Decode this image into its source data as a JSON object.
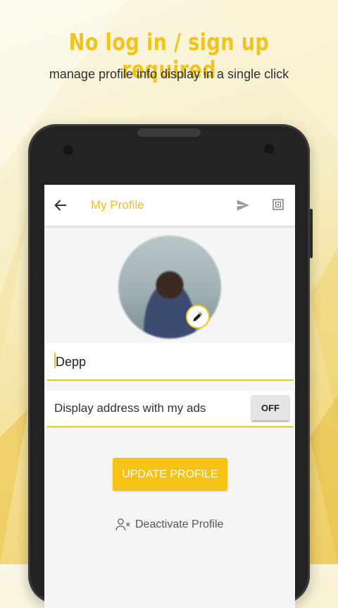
{
  "promo": {
    "headline": "No log in / sign up required",
    "subline": "manage profile info display in a single click"
  },
  "app": {
    "title": "My Profile",
    "icons": {
      "back": "arrow-left-icon",
      "send": "send-icon",
      "qr": "qr-code-icon",
      "edit": "pencil-icon",
      "deactivate": "user-remove-icon"
    }
  },
  "profile": {
    "name_value": "Depp",
    "display_address_label": "Display address with my ads",
    "display_address_toggle": "OFF",
    "update_button": "UPDATE PROFILE",
    "deactivate_label": "Deactivate Profile"
  },
  "colors": {
    "accent": "#f2c318",
    "button": "#f6c215",
    "screen_bg": "#f5f5f5"
  }
}
